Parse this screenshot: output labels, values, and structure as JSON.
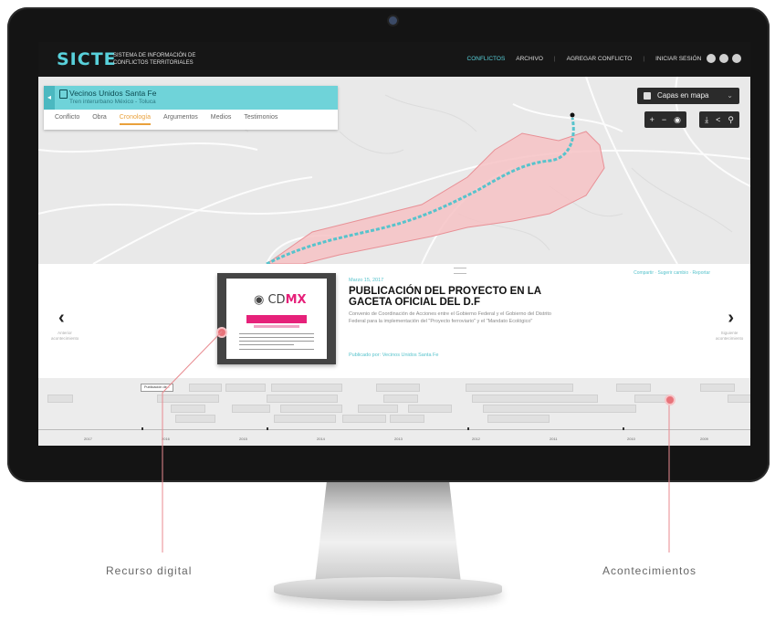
{
  "header": {
    "logo": "SICTE",
    "logo_subtitle": "SISTEMA DE INFORMACIÓN DE CONFLICTOS TERRITORIALES",
    "nav": [
      "CONFLICTOS",
      "ARCHIVO",
      "AGREGAR CONFLICTO",
      "INICIAR SESIÓN"
    ]
  },
  "conflict": {
    "title": "Vecinos Unidos Santa Fe",
    "subtitle": "Tren interurbano México - Toluca",
    "tabs": [
      "Conflicto",
      "Obra",
      "Cronología",
      "Argumentos",
      "Medios",
      "Testimonios"
    ],
    "active_tab": "Cronología"
  },
  "map": {
    "layers_label": "Capas en mapa",
    "zoom_controls": [
      "+",
      "−",
      "◉"
    ],
    "extra_controls": [
      "⤓",
      "<",
      "⚲"
    ],
    "colors": {
      "polygon_fill": "#f6c2c4",
      "polygon_stroke": "#e88f95",
      "route": "#57c3cc"
    }
  },
  "event": {
    "date": "Marzo 15, 2017",
    "title": "PUBLICACIÓN DEL PROYECTO EN LA GACETA OFICIAL DEL D.F",
    "description": "Convenio de Coordinación de Acciones entre el Gobierno Federal y el Gobierno del Distrito Federal para la implementación del \"Proyecto ferroviario\" y el \"Mandato Ecológico\"",
    "published_by": "Publicado por: Vecinos Unidos Santa Fe",
    "share_links": "Compartir · Sugerir cambio · Reportar",
    "doc_logo_a": "CD",
    "doc_logo_b": "MX",
    "prev_caption": "Anterior acontecimiento",
    "next_caption": "Siguiente acontecimiento"
  },
  "timeline": {
    "selected_item": "Publicación de...",
    "years": [
      "2017",
      "2016",
      "2015",
      "2014",
      "2013",
      "2012",
      "2011",
      "2010",
      "2009"
    ]
  },
  "callouts": {
    "left": "Recurso digital",
    "right": "Acontecimientos"
  }
}
